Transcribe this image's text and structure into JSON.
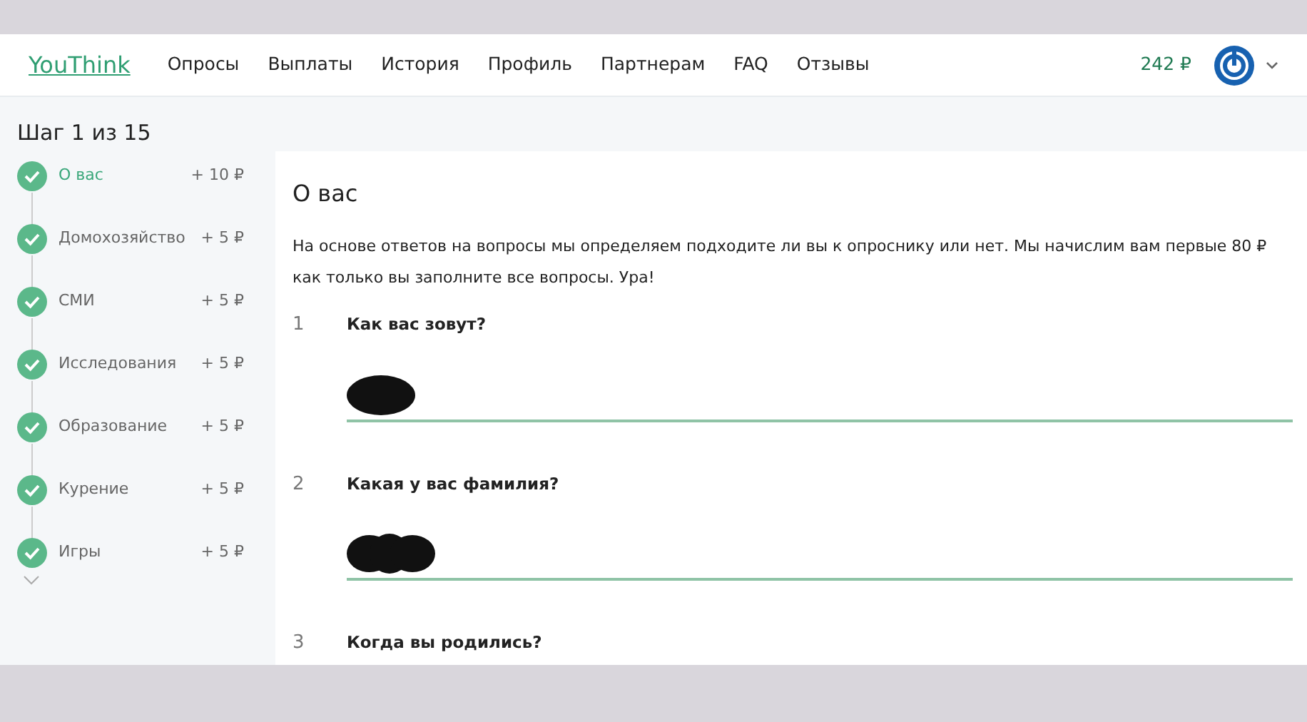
{
  "navbar": {
    "brand": "YouThink",
    "links": [
      {
        "label": "Опросы"
      },
      {
        "label": "Выплаты"
      },
      {
        "label": "История"
      },
      {
        "label": "Профиль"
      },
      {
        "label": "Партнерам"
      },
      {
        "label": "FAQ"
      },
      {
        "label": "Отзывы"
      }
    ],
    "balance": "242 ₽"
  },
  "sidebar": {
    "title": "Шаг 1 из 15",
    "steps": [
      {
        "label": "О вас",
        "bonus": "+ 10 ₽",
        "done": true,
        "selected": true
      },
      {
        "label": "Домохозяйство",
        "bonus": "+ 5 ₽",
        "done": true,
        "selected": false
      },
      {
        "label": "СМИ",
        "bonus": "+ 5 ₽",
        "done": true,
        "selected": false
      },
      {
        "label": "Исследования",
        "bonus": "+ 5 ₽",
        "done": true,
        "selected": false
      },
      {
        "label": "Образование",
        "bonus": "+ 5 ₽",
        "done": true,
        "selected": false
      },
      {
        "label": "Курение",
        "bonus": "+ 5 ₽",
        "done": true,
        "selected": false
      },
      {
        "label": "Игры",
        "bonus": "+ 5 ₽",
        "done": true,
        "selected": false
      }
    ]
  },
  "main": {
    "title": "О вас",
    "intro": "На основе ответов на вопросы мы определяем подходите ли вы к опроснику или нет. Мы начислим вам первые 80 ₽ как только вы заполните все вопросы. Ура!",
    "questions": [
      {
        "number": "1",
        "text": "Как вас зовут?",
        "kind": "text",
        "redacted": true
      },
      {
        "number": "2",
        "text": "Какая у вас фамилия?",
        "kind": "text",
        "redacted": true
      },
      {
        "number": "3",
        "text": "Когда вы родились?",
        "kind": "cut"
      }
    ]
  }
}
